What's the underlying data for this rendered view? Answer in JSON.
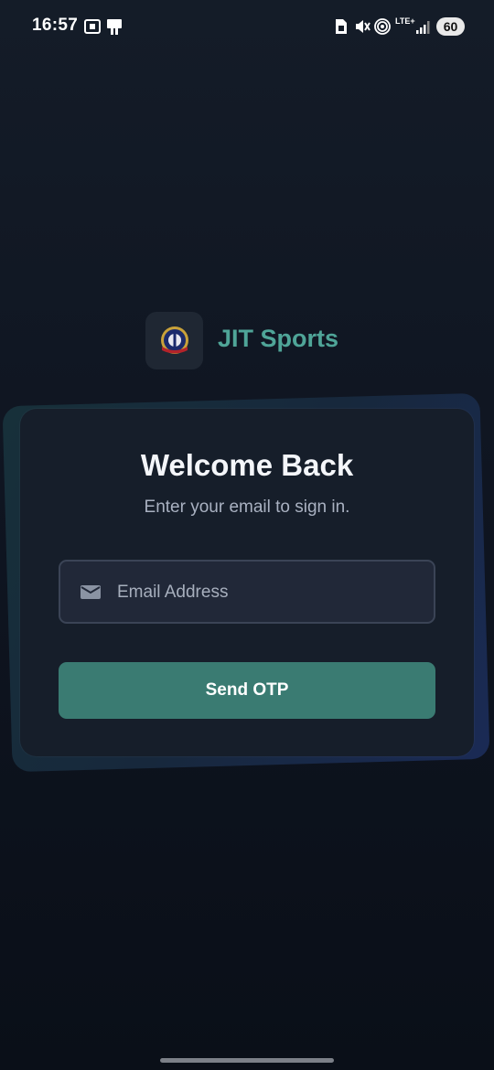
{
  "status_bar": {
    "time": "16:57",
    "battery": "60",
    "icons": [
      "screenshot-icon",
      "nfc-icon",
      "sim-icon",
      "mute-icon",
      "hotspot-icon",
      "lte-icon",
      "signal-icon"
    ],
    "lte_label": "LTE+"
  },
  "brand": {
    "name": "JIT Sports",
    "accent_color": "#4fa598"
  },
  "login": {
    "title": "Welcome Back",
    "subtitle": "Enter your email to sign in.",
    "email_placeholder": "Email Address",
    "email_value": "",
    "submit_label": "Send OTP",
    "button_color": "#3a7b72"
  }
}
